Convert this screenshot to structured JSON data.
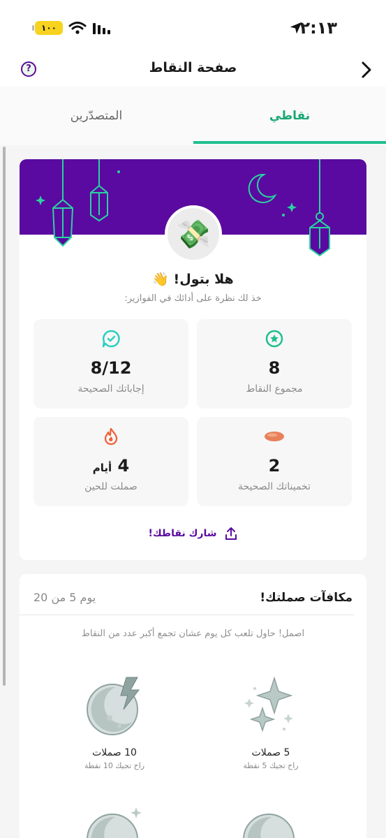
{
  "status_bar": {
    "time": "٢:١٣",
    "battery": "١٠٠"
  },
  "nav": {
    "title": "صفحة النقاط"
  },
  "tabs": [
    {
      "label": "نقاطي",
      "active": true
    },
    {
      "label": "المتصدّرين",
      "active": false
    }
  ],
  "points_card": {
    "greeting": "هلا بتول! 👋",
    "subtitle": "خذ لك نظرة على أدائك في الفوازير:",
    "stats": {
      "total_points": {
        "value": "8",
        "label": "مجموع النقاط",
        "icon": "star-badge-icon"
      },
      "correct_answers": {
        "value": "8/12",
        "label": "إجاباتك الصحيحة",
        "icon": "chat-check-icon"
      },
      "correct_guesses": {
        "value": "2",
        "label": "تخميناتك الصحيحة",
        "icon": "date-fruit-icon"
      },
      "streak": {
        "value": "4",
        "unit": "أيام",
        "label": "صملت للحين",
        "icon": "flame-icon"
      }
    },
    "share_label": "شارك نقاطك!"
  },
  "rewards_card": {
    "title": "مكافآت صملتك!",
    "day_progress": "يوم 5 من 20",
    "hint": "اصمل! حاول تلعب كل يوم عشان تجمع أكبر عدد من النقاط",
    "rewards": [
      {
        "name": "5 صملات",
        "desc": "راح تجيك 5 نقطة",
        "icon": "sparkles-icon"
      },
      {
        "name": "10 صملات",
        "desc": "راح تجيك 10 نقطة",
        "icon": "moon-lightning-icon"
      }
    ]
  },
  "colors": {
    "brand_purple": "#5a0aa0",
    "accent_green": "#1fbf8f",
    "streak_orange": "#f0603a"
  }
}
